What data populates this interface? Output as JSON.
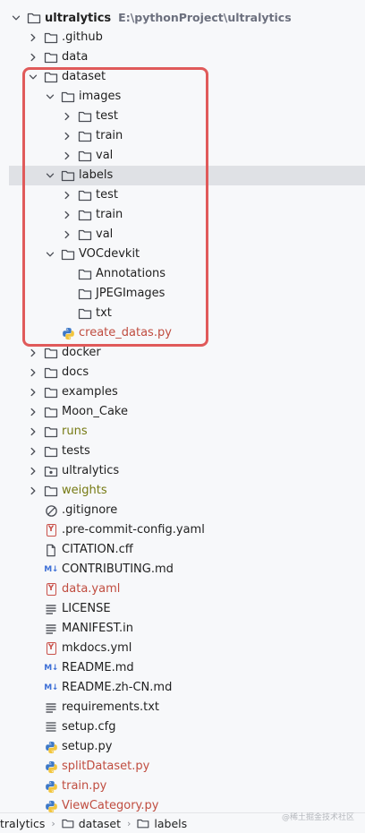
{
  "tree": [
    {
      "label": "ultralytics",
      "hint": "E:\\pythonProject\\ultralytics",
      "depth": 0,
      "kind": "folder",
      "expanded": true,
      "root": true
    },
    {
      "label": ".github",
      "depth": 1,
      "kind": "folder",
      "expanded": false
    },
    {
      "label": "data",
      "depth": 1,
      "kind": "folder",
      "expanded": false
    },
    {
      "label": "dataset",
      "depth": 1,
      "kind": "folder",
      "expanded": true
    },
    {
      "label": "images",
      "depth": 2,
      "kind": "folder",
      "expanded": true
    },
    {
      "label": "test",
      "depth": 3,
      "kind": "folder",
      "expanded": false
    },
    {
      "label": "train",
      "depth": 3,
      "kind": "folder",
      "expanded": false
    },
    {
      "label": "val",
      "depth": 3,
      "kind": "folder",
      "expanded": false
    },
    {
      "label": "labels",
      "depth": 2,
      "kind": "folder",
      "expanded": true,
      "selected": true
    },
    {
      "label": "test",
      "depth": 3,
      "kind": "folder",
      "expanded": false
    },
    {
      "label": "train",
      "depth": 3,
      "kind": "folder",
      "expanded": false
    },
    {
      "label": "val",
      "depth": 3,
      "kind": "folder",
      "expanded": false
    },
    {
      "label": "VOCdevkit",
      "depth": 2,
      "kind": "folder",
      "expanded": true
    },
    {
      "label": "Annotations",
      "depth": 3,
      "kind": "folder",
      "leaf": true
    },
    {
      "label": "JPEGImages",
      "depth": 3,
      "kind": "folder",
      "leaf": true
    },
    {
      "label": "txt",
      "depth": 3,
      "kind": "folder",
      "leaf": true
    },
    {
      "label": "create_datas.py",
      "depth": 2,
      "kind": "python",
      "color": "red",
      "leaf": true
    },
    {
      "label": "docker",
      "depth": 1,
      "kind": "folder",
      "expanded": false
    },
    {
      "label": "docs",
      "depth": 1,
      "kind": "folder",
      "expanded": false
    },
    {
      "label": "examples",
      "depth": 1,
      "kind": "folder",
      "expanded": false
    },
    {
      "label": "Moon_Cake",
      "depth": 1,
      "kind": "folder",
      "expanded": false
    },
    {
      "label": "runs",
      "depth": 1,
      "kind": "folder",
      "expanded": false,
      "color": "olive"
    },
    {
      "label": "tests",
      "depth": 1,
      "kind": "folder",
      "expanded": false
    },
    {
      "label": "ultralytics",
      "depth": 1,
      "kind": "package",
      "expanded": false
    },
    {
      "label": "weights",
      "depth": 1,
      "kind": "folder",
      "expanded": false,
      "color": "olive"
    },
    {
      "label": ".gitignore",
      "depth": 1,
      "kind": "gitignore",
      "leaf": true
    },
    {
      "label": ".pre-commit-config.yaml",
      "depth": 1,
      "kind": "yaml",
      "leaf": true
    },
    {
      "label": "CITATION.cff",
      "depth": 1,
      "kind": "file",
      "leaf": true
    },
    {
      "label": "CONTRIBUTING.md",
      "depth": 1,
      "kind": "markdown",
      "leaf": true
    },
    {
      "label": "data.yaml",
      "depth": 1,
      "kind": "yaml",
      "color": "red",
      "leaf": true
    },
    {
      "label": "LICENSE",
      "depth": 1,
      "kind": "text",
      "leaf": true
    },
    {
      "label": "MANIFEST.in",
      "depth": 1,
      "kind": "text",
      "leaf": true
    },
    {
      "label": "mkdocs.yml",
      "depth": 1,
      "kind": "yaml",
      "leaf": true
    },
    {
      "label": "README.md",
      "depth": 1,
      "kind": "markdown",
      "leaf": true
    },
    {
      "label": "README.zh-CN.md",
      "depth": 1,
      "kind": "markdown",
      "leaf": true
    },
    {
      "label": "requirements.txt",
      "depth": 1,
      "kind": "text",
      "leaf": true
    },
    {
      "label": "setup.cfg",
      "depth": 1,
      "kind": "config",
      "leaf": true
    },
    {
      "label": "setup.py",
      "depth": 1,
      "kind": "python",
      "leaf": true
    },
    {
      "label": "splitDataset.py",
      "depth": 1,
      "kind": "python",
      "color": "red",
      "leaf": true
    },
    {
      "label": "train.py",
      "depth": 1,
      "kind": "python",
      "color": "red",
      "leaf": true
    },
    {
      "label": "ViewCategory.py",
      "depth": 1,
      "kind": "python",
      "color": "red",
      "leaf": true
    }
  ],
  "breadcrumb": {
    "items": [
      "tralytics",
      "dataset",
      "labels"
    ],
    "separator": "›"
  },
  "watermark": "@稀土掘金技术社区",
  "colors": {
    "highlight": "#e05a5a",
    "modified_red": "#c04d40",
    "excluded_olive": "#767a13",
    "selection": "#dfe1e5"
  }
}
